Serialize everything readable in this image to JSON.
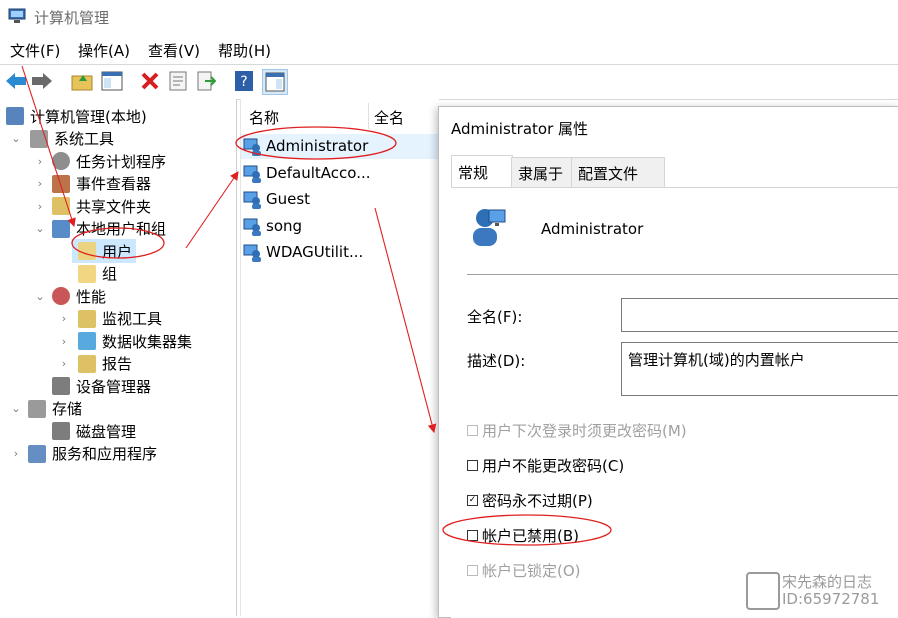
{
  "window": {
    "title": "计算机管理"
  },
  "menu": [
    "文件(F)",
    "操作(A)",
    "查看(V)",
    "帮助(H)"
  ],
  "toolbar": [
    "back-icon",
    "forward-icon",
    "up-folder-icon",
    "show-hide-tree-icon",
    "delete-icon",
    "properties-icon",
    "export-icon",
    "help-icon",
    "action-pane-icon"
  ],
  "tree": [
    {
      "label": "计算机管理(本地)",
      "icon": "computer-management-icon",
      "chev": ""
    },
    {
      "label": "系统工具",
      "icon": "tools-icon",
      "chev": "⌄"
    },
    {
      "label": "任务计划程序",
      "icon": "clock-icon",
      "chev": "›"
    },
    {
      "label": "事件查看器",
      "icon": "event-viewer-icon",
      "chev": "›"
    },
    {
      "label": "共享文件夹",
      "icon": "shared-folder-icon",
      "chev": "›"
    },
    {
      "label": "本地用户和组",
      "icon": "users-icon",
      "chev": "⌄"
    },
    {
      "label": "用户",
      "icon": "folder-icon",
      "chev": ""
    },
    {
      "label": "组",
      "icon": "folder-icon",
      "chev": ""
    },
    {
      "label": "性能",
      "icon": "performance-icon",
      "chev": "⌄"
    },
    {
      "label": "监视工具",
      "icon": "monitor-folder-icon",
      "chev": "›"
    },
    {
      "label": "数据收集器集",
      "icon": "data-collector-icon",
      "chev": "›"
    },
    {
      "label": "报告",
      "icon": "report-folder-icon",
      "chev": "›"
    },
    {
      "label": "设备管理器",
      "icon": "device-manager-icon",
      "chev": ""
    },
    {
      "label": "存储",
      "icon": "storage-icon",
      "chev": "⌄"
    },
    {
      "label": "磁盘管理",
      "icon": "disk-icon",
      "chev": ""
    },
    {
      "label": "服务和应用程序",
      "icon": "services-icon",
      "chev": "›"
    }
  ],
  "list": {
    "headers": [
      "名称",
      "全名"
    ],
    "rows": [
      "Administrator",
      "DefaultAcco...",
      "Guest",
      "song",
      "WDAGUtilit..."
    ]
  },
  "dialog": {
    "title": "Administrator 属性",
    "tabs": [
      "常规",
      "隶属于",
      "配置文件"
    ],
    "username": "Administrator",
    "fullname_label": "全名(F):",
    "fullname_value": "",
    "desc_label": "描述(D):",
    "desc_value": "管理计算机(域)的内置帐户",
    "checks": [
      {
        "label": "用户下次登录时须更改密码(M)",
        "checked": false,
        "disabled": true
      },
      {
        "label": "用户不能更改密码(C)",
        "checked": false,
        "disabled": false
      },
      {
        "label": "密码永不过期(P)",
        "checked": true,
        "disabled": false
      },
      {
        "label": "帐户已禁用(B)",
        "checked": false,
        "disabled": false
      },
      {
        "label": "帐户已锁定(O)",
        "checked": false,
        "disabled": true
      }
    ]
  },
  "watermark": {
    "line1": "宋先森的日志",
    "line2": "ID:65972781"
  },
  "colors": {
    "annotation": "#e02020",
    "selection": "#cce8ff",
    "highlight_row": "#e5f3ff"
  }
}
